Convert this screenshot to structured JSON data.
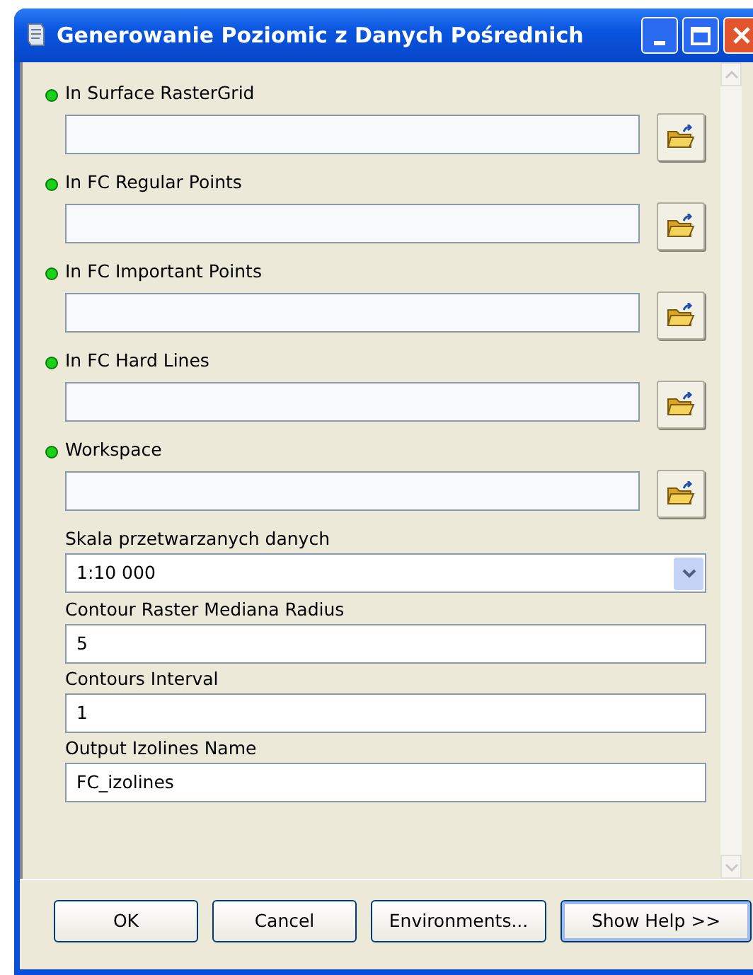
{
  "window": {
    "title": "Generowanie Poziomic z Danych Pośrednich"
  },
  "parameters": [
    {
      "kind": "file",
      "label": "In Surface RasterGrid",
      "required": true
    },
    {
      "kind": "file",
      "label": "In FC Regular Points",
      "required": true
    },
    {
      "kind": "file",
      "label": "In FC Important Points",
      "required": true
    },
    {
      "kind": "file",
      "label": "In FC Hard Lines",
      "required": true
    },
    {
      "kind": "file",
      "label": "Workspace",
      "required": true
    },
    {
      "kind": "select",
      "label": "Skala przetwarzanych danych",
      "value": "1:10 000",
      "required": false
    },
    {
      "kind": "text",
      "label": "Contour Raster Mediana Radius",
      "value": "5",
      "required": false
    },
    {
      "kind": "text",
      "label": "Contours Interval",
      "value": "1",
      "required": false
    },
    {
      "kind": "text",
      "label": "Output Izolines Name",
      "value": "FC_izolines",
      "required": false
    }
  ],
  "buttons": [
    "OK",
    "Cancel",
    "Environments...",
    "Show Help >>"
  ]
}
